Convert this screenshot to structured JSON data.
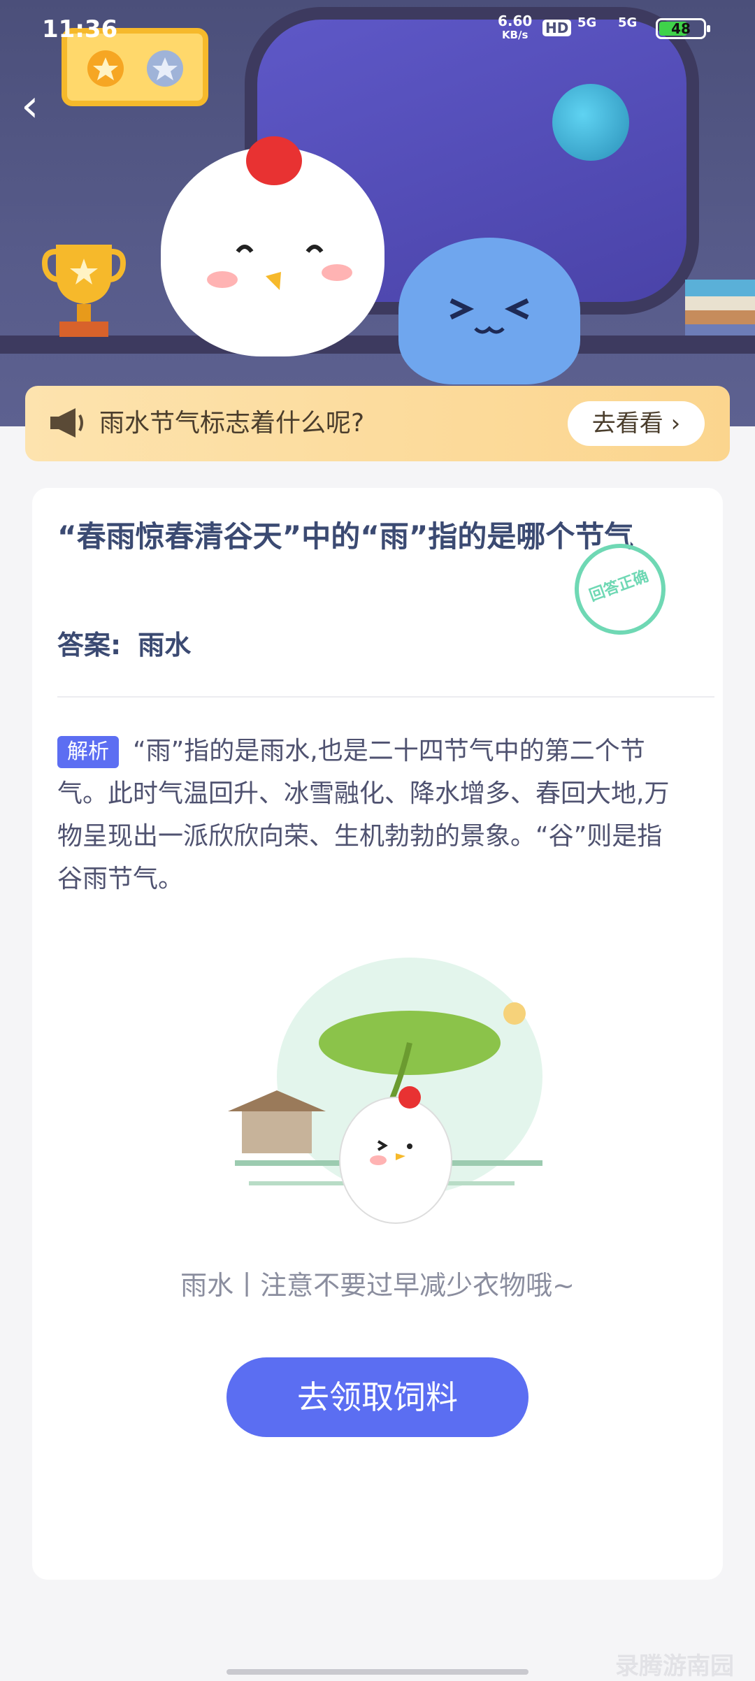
{
  "status": {
    "time": "11:36",
    "net_speed": "6.60",
    "net_unit": "KB/s",
    "hd": "HD",
    "signal1": "5G",
    "signal2": "5G",
    "battery": "48"
  },
  "nav": {
    "back": "‹"
  },
  "banner": {
    "text": "雨水节气标志着什么呢?",
    "button": "去看看 ›"
  },
  "question": {
    "title": "“春雨惊春清谷天”中的“雨”指的是哪个节气",
    "stamp": "回答正确",
    "answer_label": "答案:",
    "answer_value": "雨水"
  },
  "explanation": {
    "tag": "解析",
    "text": "“雨”指的是雨水,也是二十四节气中的第二个节气。此时气温回升、冰雪融化、降水增多、春回大地,万物呈现出一派欣欣向荣、生机勃勃的景象。“谷”则是指谷雨节气。"
  },
  "illustration": {
    "caption": "雨水丨注意不要过早减少衣物哦~"
  },
  "cta": {
    "label": "去领取饲料"
  },
  "watermark": "录腾游南园",
  "colors": {
    "accent": "#5b6ef2",
    "banner": "#fbd58e",
    "title": "#3b4a72",
    "stamp": "#6fd8b4"
  }
}
